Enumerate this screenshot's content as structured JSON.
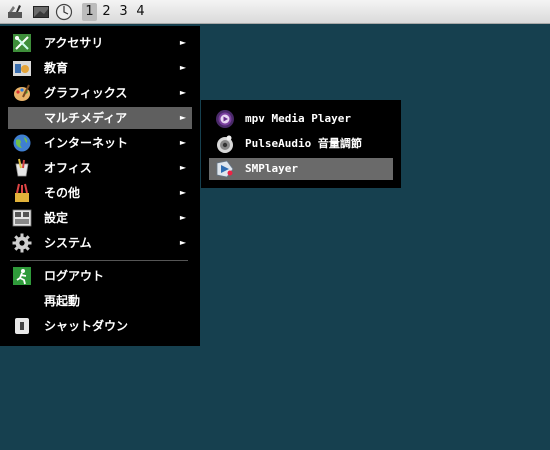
{
  "panel": {
    "launchers": [
      {
        "icon": "settings-tools-icon"
      },
      {
        "icon": "window-thumbnail-icon"
      },
      {
        "icon": "globe-clock-icon"
      }
    ],
    "workspaces": [
      "1",
      "2",
      "3",
      "4"
    ],
    "active_workspace": "1"
  },
  "main_menu": {
    "items": [
      {
        "label": "アクセサリ",
        "icon": "accessories-icon",
        "submenu": true
      },
      {
        "label": "教育",
        "icon": "education-icon",
        "submenu": true
      },
      {
        "label": "グラフィックス",
        "icon": "graphics-palette-icon",
        "submenu": true
      },
      {
        "label": "マルチメディア",
        "icon": "multimedia-icon",
        "submenu": true,
        "highlighted": true
      },
      {
        "label": "インターネット",
        "icon": "internet-globe-icon",
        "submenu": true
      },
      {
        "label": "オフィス",
        "icon": "office-icon",
        "submenu": true
      },
      {
        "label": "その他",
        "icon": "other-paint-icon",
        "submenu": true
      },
      {
        "label": "設定",
        "icon": "settings-panel-icon",
        "submenu": true
      },
      {
        "label": "システム",
        "icon": "system-gear-icon",
        "submenu": true
      }
    ],
    "session": [
      {
        "label": "ログアウト",
        "icon": "logout-exit-icon"
      },
      {
        "label": "再起動",
        "icon": ""
      },
      {
        "label": "シャットダウン",
        "icon": "shutdown-icon"
      }
    ],
    "arrow": "►"
  },
  "sub_menu": {
    "items": [
      {
        "label": "mpv Media Player",
        "icon": "mpv-icon"
      },
      {
        "label": "PulseAudio 音量調節",
        "icon": "pulseaudio-speaker-icon"
      },
      {
        "label": "SMPlayer",
        "icon": "smplayer-icon",
        "highlighted": true
      }
    ]
  },
  "colors": {
    "desktop": "#16404f",
    "menu_bg": "#000000",
    "highlight": "#5f5f5f",
    "panel": "#e8e8e8"
  }
}
